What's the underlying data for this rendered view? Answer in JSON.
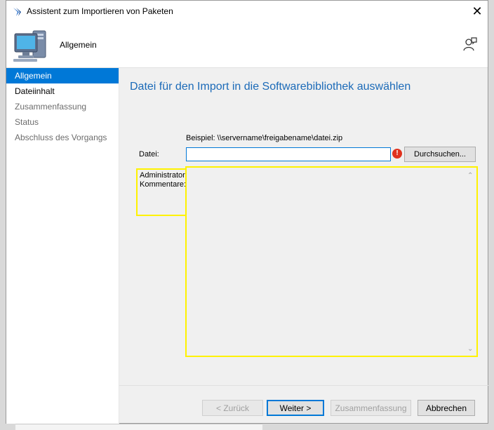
{
  "window": {
    "title": "Assistent zum Importieren von Paketen",
    "close_glyph": "✕"
  },
  "header": {
    "title": "Allgemein"
  },
  "nav": {
    "items": [
      {
        "label": "Allgemein"
      },
      {
        "label": "Dateiinhalt"
      },
      {
        "label": "Zusammenfassung"
      },
      {
        "label": "Status"
      },
      {
        "label": "Abschluss des Vorgangs"
      }
    ]
  },
  "content": {
    "page_title": "Datei für den Import in die Softwarebibliothek auswählen",
    "example_text": "Beispiel: \\\\servername\\freigabename\\datei.zip",
    "file_label": "Datei:",
    "file_value": "",
    "browse_label": "Durchsuchen...",
    "error_glyph": "!",
    "admin_label": "Administrator-Kommentare:",
    "comments_value": "",
    "scroll_up_glyph": "⌃",
    "scroll_down_glyph": "⌄"
  },
  "footer": {
    "back_label": "< Zurück",
    "next_label": "Weiter >",
    "summary_label": "Zusammenfassung",
    "cancel_label": "Abbrechen"
  },
  "colors": {
    "accent": "#0078d7",
    "title_blue": "#1b6ab8",
    "highlight": "#fff200",
    "error": "#e0321e"
  }
}
